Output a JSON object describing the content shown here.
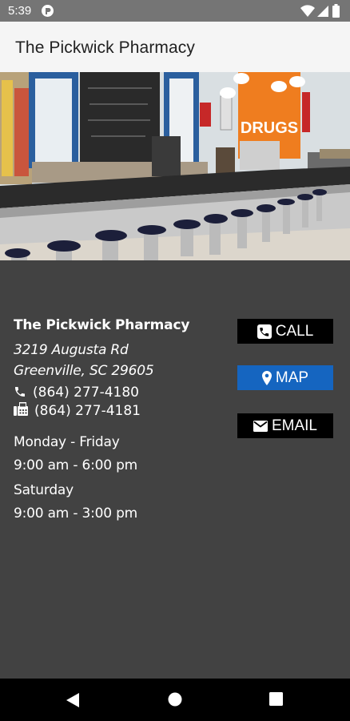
{
  "status_bar": {
    "time": "5:39",
    "icons": [
      "app-notification-icon",
      "wifi-icon",
      "cell-signal-icon",
      "battery-icon"
    ]
  },
  "app_bar": {
    "title": "The Pickwick Pharmacy"
  },
  "hero": {
    "icon": "pharmacy-soda-fountain-photo",
    "sign_text": "DRUGS"
  },
  "info": {
    "name": "The Pickwick Pharmacy",
    "address_line1": "3219 Augusta Rd",
    "address_line2": "Greenville, SC 29605",
    "phone": "(864) 277-4180",
    "fax": "(864) 277-4181",
    "hours": [
      {
        "label": "Monday - Friday",
        "time": "9:00 am - 6:00 pm"
      },
      {
        "label": "Saturday",
        "time": "9:00 am - 3:00 pm"
      }
    ]
  },
  "buttons": {
    "call": "CALL",
    "map": "MAP",
    "email": "EMAIL"
  },
  "colors": {
    "map_button": "#1565c0",
    "content_bg": "#424242",
    "status_bar": "#757575"
  },
  "nav_bar": {
    "icons": [
      "back-icon",
      "home-icon",
      "recents-icon"
    ]
  }
}
